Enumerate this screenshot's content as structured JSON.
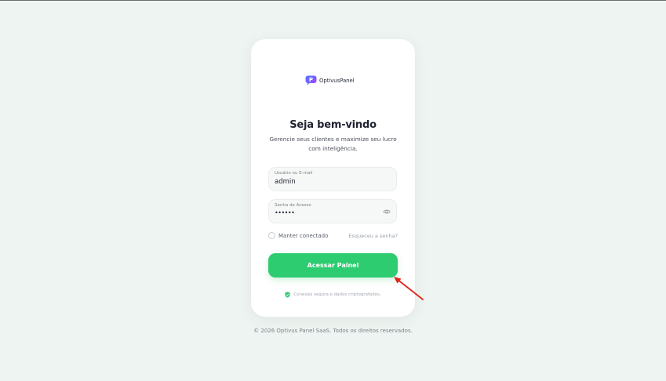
{
  "brand": {
    "name": "OptivusPanel",
    "logo_icon": "chat-bubble-icon",
    "colors": {
      "primary_green": "#2ecc71",
      "logo_gradient_start": "#4f7cff",
      "logo_gradient_end": "#a246ff"
    }
  },
  "login": {
    "title": "Seja bem-vindo",
    "subtitle": "Gerencie seus clientes e maximize seu lucro com inteligência.",
    "username": {
      "label": "Usuário ou E-mail",
      "value": "admin"
    },
    "password": {
      "label": "Senha de Acesso",
      "value": "••••••",
      "toggle_icon": "eye-icon"
    },
    "remember_label": "Manter conectado",
    "remember_checked": false,
    "forgot_label": "Esqueceu a senha?",
    "submit_label": "Acessar Painel",
    "secure_text": "Conexão segura e dados criptografados.",
    "secure_icon": "shield-icon"
  },
  "footer": {
    "copyright": "© 2026 Optivus Panel SaaS. Todos os direitos reservados."
  },
  "annotation": {
    "icon": "red-arrow-icon",
    "color": "#e0241b"
  }
}
